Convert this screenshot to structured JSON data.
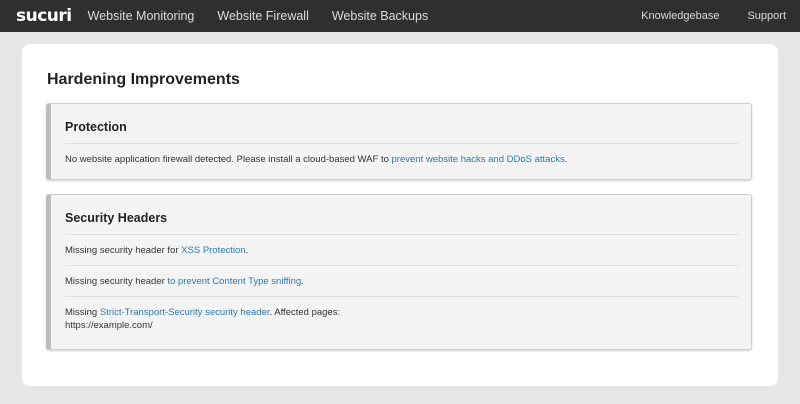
{
  "nav": {
    "logo": "sucuri",
    "items": [
      "Website Monitoring",
      "Website Firewall",
      "Website Backups"
    ],
    "right_items": [
      "Knowledgebase",
      "Support"
    ]
  },
  "page": {
    "title": "Hardening Improvements"
  },
  "panels": [
    {
      "title": "Protection",
      "rows": [
        {
          "before": "No website application firewall detected. Please install a cloud-based WAF to ",
          "link": "prevent website hacks and DDoS attacks",
          "after": "."
        }
      ]
    },
    {
      "title": "Security Headers",
      "rows": [
        {
          "before": "Missing security header for ",
          "link": "XSS Protection",
          "after": "."
        },
        {
          "before": "Missing security header ",
          "link": "to prevent Content Type sniffing",
          "after": "."
        },
        {
          "before": "Missing ",
          "link": "Strict-Transport-Security security header",
          "after": ". Affected pages:",
          "line2": "https://example.com/"
        }
      ]
    }
  ],
  "colors": {
    "topbar_bg": "#2f2f2f",
    "page_bg": "#e6e6e6",
    "link": "#2a7ab0",
    "panel_accent": "#bdbdbd"
  }
}
